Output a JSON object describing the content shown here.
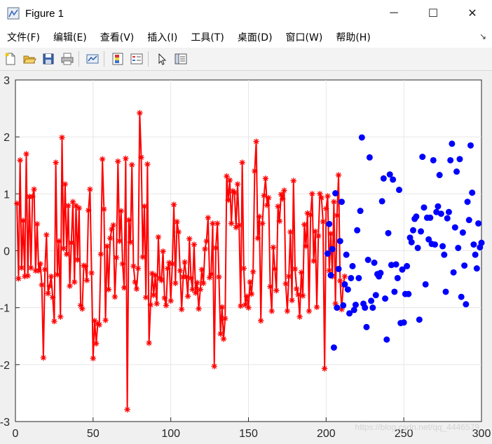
{
  "window": {
    "title": "Figure 1",
    "minimize_glyph": "─",
    "maximize_glyph": "☐",
    "close_glyph": "✕"
  },
  "menu": {
    "items": [
      "文件(F)",
      "编辑(E)",
      "查看(V)",
      "插入(I)",
      "工具(T)",
      "桌面(D)",
      "窗口(W)",
      "帮助(H)"
    ],
    "dock_glyph": "↘"
  },
  "toolbar": {
    "icons": [
      "new-figure-icon",
      "open-icon",
      "save-icon",
      "print-icon",
      "link-plot-icon",
      "colorbar-icon",
      "legend-icon",
      "pointer-icon",
      "plot-tools-icon"
    ]
  },
  "watermark": "https://blog.csdn.net/qq_4446579",
  "colors": {
    "series_train": "#ff0000",
    "series_test": "#0000ff",
    "axes_bg": "#ffffff",
    "grid": "#e6e6e6"
  },
  "chart_data": {
    "type": "scatter",
    "title": "",
    "xlabel": "",
    "ylabel": "",
    "xlim": [
      0,
      300
    ],
    "ylim": [
      -3,
      3
    ],
    "xticks": [
      0,
      50,
      100,
      150,
      200,
      250,
      300
    ],
    "yticks": [
      -3,
      -2,
      -1,
      0,
      1,
      2,
      3
    ],
    "grid": true,
    "series": [
      {
        "style": "line-star",
        "color": "#ff0000",
        "x_start": 1,
        "values": [
          0.83,
          -0.49,
          1.59,
          -0.3,
          0.53,
          -0.45,
          1.7,
          -0.44,
          0.95,
          -0.3,
          0.95,
          1.08,
          -0.35,
          0.47,
          -0.35,
          -0.23,
          -0.6,
          -1.88,
          -0.33,
          0.28,
          -0.75,
          -0.62,
          -0.45,
          -0.82,
          -1.24,
          1.55,
          -0.42,
          0.17,
          -1.16,
          1.99,
          0.04,
          1.17,
          -0.06,
          0.79,
          -0.62,
          0.14,
          0.86,
          -0.55,
          0.79,
          -0.16,
          0.75,
          -0.96,
          -1.02,
          -0.26,
          -0.27,
          -0.52,
          0.71,
          1.08,
          -0.39,
          -1.89,
          -1.23,
          -1.63,
          -1.28,
          -1.3,
          -0.06,
          1.61,
          0.73,
          -1.22,
          0.08,
          -0.68,
          0.22,
          0.38,
          0.45,
          -0.81,
          -0.12,
          1.57,
          0.17,
          0.7,
          -0.23,
          -0.65,
          1.62,
          -2.79,
          0.54,
          0.15,
          1.51,
          -0.27,
          -0.55,
          -0.67,
          -0.31,
          2.42,
          1.64,
          -0.11,
          0.78,
          -0.82,
          1.52,
          -1.62,
          -0.95,
          -0.4,
          -0.78,
          -0.43,
          -0.93,
          0.24,
          -0.48,
          -0.52,
          -0.01,
          -0.83,
          -0.96,
          -0.31,
          -0.21,
          -0.88,
          -0.23,
          0.81,
          -0.57,
          0.51,
          0.33,
          -0.35,
          -1.03,
          -0.46,
          -0.2,
          -0.46,
          -0.8,
          0.21,
          -0.48,
          -0.68,
          0.11,
          -0.74,
          -0.56,
          -1.02,
          -0.68,
          -0.33,
          -0.57,
          0.03,
          0.17,
          0.58,
          -0.47,
          -0.41,
          0.48,
          -2.03,
          0.05,
          0.48,
          -0.46,
          -1.46,
          -0.99,
          -1.55,
          -1.19,
          1.31,
          0.89,
          1.24,
          0.48,
          1.05,
          1.02,
          0.41,
          1.17,
          0.45,
          -0.97,
          1.55,
          -0.31,
          -0.95,
          -0.8,
          -1.0,
          -0.55,
          -0.76,
          -0.37,
          1.4,
          1.92,
          0.22,
          0.6,
          -1.23,
          0.48,
          0.97,
          1.27,
          0.8,
          0.93,
          -0.63,
          -1.06,
          0.06,
          -0.32,
          -0.7,
          0.78,
          0.52,
          0.99,
          0.91,
          1.06,
          -0.58,
          -1.06,
          -0.45,
          0.33,
          -0.87,
          1.23,
          -0.32,
          -0.67,
          -0.77,
          -1.16,
          -0.38,
          -0.79,
          0.46,
          0.08,
          0.66,
          -1.06,
          0.63,
          1.0,
          -0.18,
          0.34,
          -0.99,
          0.26,
          1.0,
          0.93,
          0.51,
          -2.07,
          0.74,
          0.96,
          -0.35,
          0.3,
          -0.45,
          0.86,
          -0.93,
          0.62,
          1.33,
          -0.53,
          -1.03,
          -0.6,
          -0.45
        ]
      },
      {
        "style": "dots",
        "color": "#0000ff",
        "x_start": 201,
        "values": [
          -0.05,
          0.47,
          -0.43,
          0.03,
          -1.7,
          1.01,
          -1.0,
          -0.32,
          0.17,
          0.86,
          -0.96,
          -0.59,
          -0.07,
          -0.68,
          -1.1,
          -0.48,
          -0.27,
          -1.04,
          -0.95,
          0.36,
          -0.48,
          0.7,
          1.99,
          -0.93,
          -1.0,
          -1.34,
          -0.16,
          1.64,
          -0.88,
          -1.0,
          -0.21,
          -0.78,
          -0.41,
          -0.45,
          -0.39,
          0.87,
          1.27,
          -0.84,
          -1.56,
          0.31,
          1.34,
          -0.25,
          1.25,
          -0.72,
          -0.24,
          -0.48,
          1.07,
          -1.27,
          -0.33,
          -1.26,
          -0.76,
          -0.27,
          -0.76,
          0.23,
          0.15,
          0.36,
          0.56,
          0.6,
          0.05,
          -1.21,
          0.34,
          1.65,
          0.76,
          -0.59,
          0.58,
          0.2,
          0.58,
          0.12,
          1.59,
          0.11,
          0.68,
          0.78,
          1.33,
          0.65,
          0.08,
          -0.07,
          -0.72,
          0.57,
          0.68,
          1.59,
          1.88,
          -0.38,
          0.41,
          1.39,
          0.05,
          1.61,
          -0.81,
          0.32,
          -0.26,
          -0.94,
          0.86,
          0.54,
          1.85,
          1.02,
          0.11,
          -0.07,
          -0.31,
          0.48,
          0.06,
          0.14
        ]
      }
    ]
  }
}
